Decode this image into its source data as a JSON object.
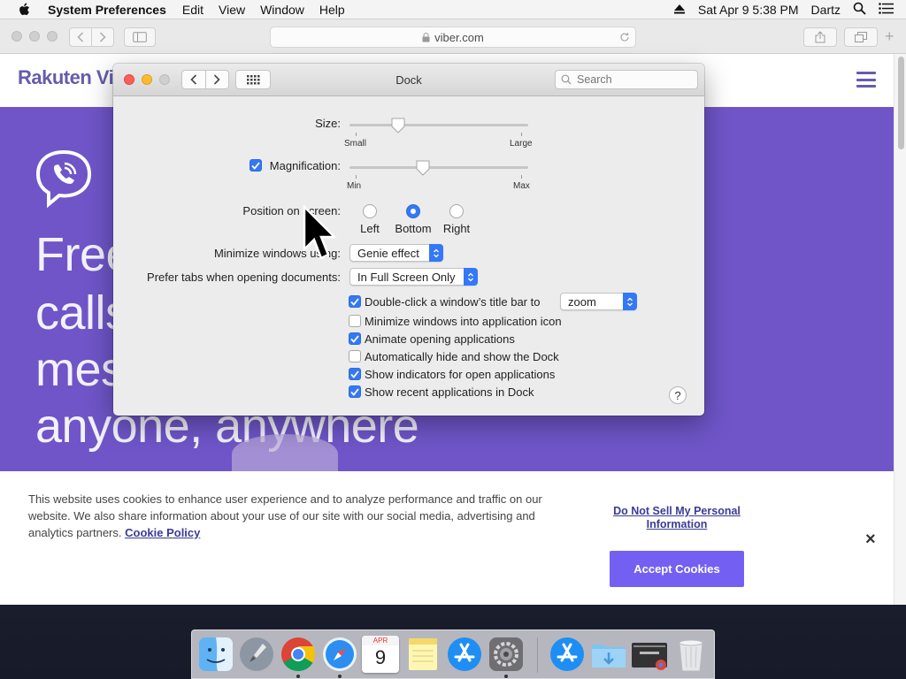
{
  "menubar": {
    "app_name": "System Preferences",
    "menus": [
      "Edit",
      "View",
      "Window",
      "Help"
    ],
    "date_time": "Sat Apr 9  5:38 PM",
    "user": "Dartz"
  },
  "safari": {
    "url": "viber.com"
  },
  "website": {
    "logo": "Rakuten Vib",
    "hero_lines": [
      "Free",
      "calls",
      "mes",
      "anyone, anywhere"
    ],
    "cookie": {
      "text": "This website uses cookies to enhance user experience and to analyze performance and traffic on our website. We also share information about your use of our site with our social media, advertising and analytics partners.",
      "policy_link": "Cookie Policy",
      "do_not_sell": "Do Not Sell My Personal Information",
      "accept": "Accept Cookies",
      "close": "×"
    }
  },
  "prefs": {
    "title": "Dock",
    "search_placeholder": "Search",
    "size_label": "Size:",
    "size_min": "Small",
    "size_max": "Large",
    "size_value": 0.27,
    "magnification_label": "Magnification:",
    "magnification_checked": true,
    "mag_min": "Min",
    "mag_max": "Max",
    "magnification_value": 0.41,
    "position_label": "Position on screen:",
    "position_options": [
      "Left",
      "Bottom",
      "Right"
    ],
    "position_selected": "Bottom",
    "minimize_label": "Minimize windows using:",
    "minimize_value": "Genie effect",
    "tabs_label": "Prefer tabs when opening documents:",
    "tabs_value": "In Full Screen Only",
    "checkboxes": [
      {
        "label": "Double-click a window’s title bar to",
        "checked": true
      },
      {
        "label": "Minimize windows into application icon",
        "checked": false
      },
      {
        "label": "Animate opening applications",
        "checked": true
      },
      {
        "label": "Automatically hide and show the Dock",
        "checked": false
      },
      {
        "label": "Show indicators for open applications",
        "checked": true
      },
      {
        "label": "Show recent applications in Dock",
        "checked": true
      }
    ],
    "double_click_value": "zoom",
    "help": "?"
  },
  "dock": {
    "apps": [
      "finder-icon",
      "launchpad-icon",
      "chrome-icon",
      "safari-icon",
      "calendar-icon",
      "notes-icon",
      "app-store-icon",
      "system-preferences-icon",
      "app-store-recent-icon",
      "downloads-folder-icon",
      "chrome-window-icon",
      "trash-icon"
    ],
    "calendar_month": "APR",
    "calendar_day": "9"
  },
  "colors": {
    "accent": "#3478f6",
    "viber_purple": "#6f55c8",
    "accept_button": "#7360f2"
  }
}
